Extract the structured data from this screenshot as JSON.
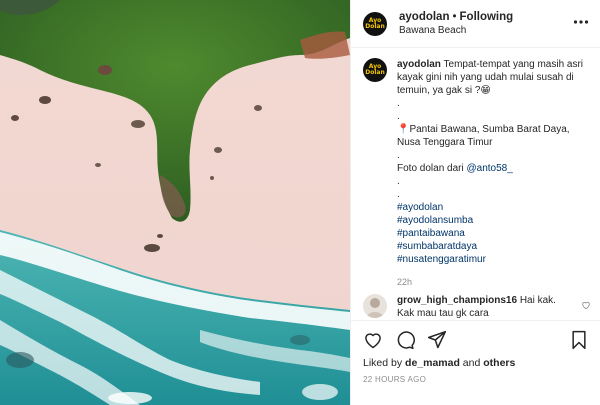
{
  "header": {
    "username": "ayodolan",
    "separator": "•",
    "follow_status": "Following",
    "location": "Bawana Beach",
    "avatar_text": "Ayo Dolan"
  },
  "caption": {
    "username": "ayodolan",
    "text": "Tempat-tempat yang masih asri kayak gini nih yang udah mulai susah di temuin, ya gak si ?😁",
    "dot1": ".",
    "dot2": ".",
    "location_line": "📍Pantai Bawana, Sumba Barat Daya, Nusa Tenggara Timur",
    "dot3": ".",
    "credit_prefix": "Foto dolan dari ",
    "credit_mention": "@anto58_",
    "dot4": ".",
    "dot5": ".",
    "hashtags": [
      "#ayodolan",
      "#ayodolansumba",
      "#pantaibawana",
      "#sumbabaratdaya",
      "#nusatenggaratimur"
    ],
    "time": "22h"
  },
  "comment": {
    "username": "grow_high_champions16",
    "text": "Hai kak. Kak mau tau gk cara"
  },
  "likes": {
    "prefix": "Liked by ",
    "user": "de_mamad",
    "middle": " and ",
    "others": "others"
  },
  "timestamp": "22 HOURS AGO",
  "colors": {
    "link": "#003569",
    "muted": "#8e8e8e",
    "text": "#262626",
    "border": "#efefef"
  }
}
